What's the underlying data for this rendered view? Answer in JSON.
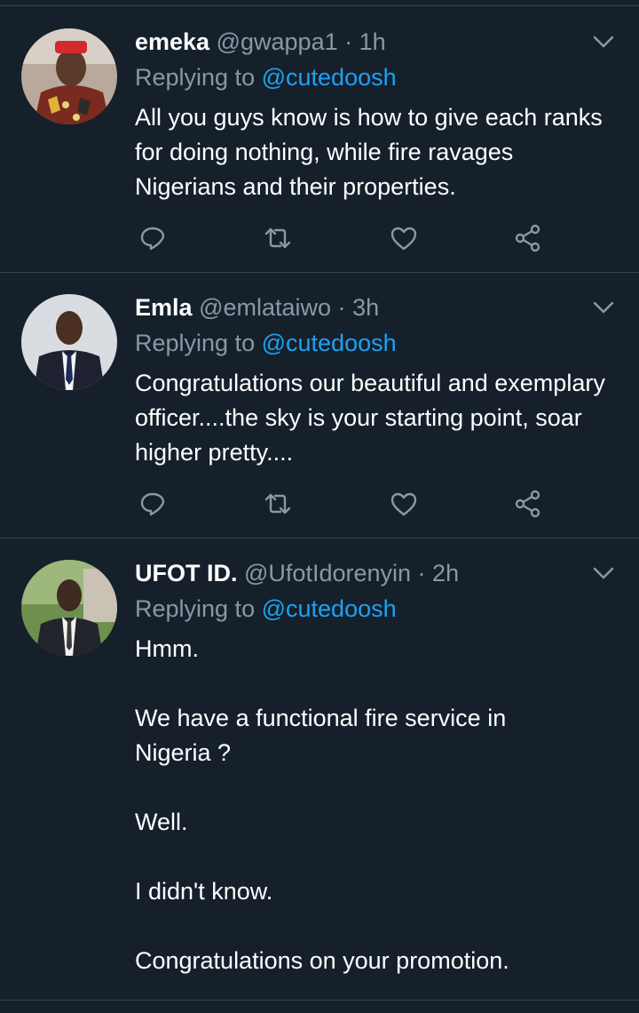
{
  "tweets": [
    {
      "display_name": "emeka",
      "handle": "@gwappa1",
      "separator": "·",
      "time": "1h",
      "replying_prefix": "Replying to",
      "replying_to": "@cutedoosh",
      "body": [
        "All you guys know is how to give each ranks for doing nothing, while fire ravages Nigerians and their properties."
      ]
    },
    {
      "display_name": "Emla",
      "handle": "@emlataiwo",
      "separator": "·",
      "time": "3h",
      "replying_prefix": "Replying to",
      "replying_to": "@cutedoosh",
      "body": [
        "Congratulations our beautiful and exemplary officer....the sky is your starting point, soar higher pretty...."
      ]
    },
    {
      "display_name": "UFOT ID.",
      "handle": "@UfotIdorenyin",
      "separator": "·",
      "time": "2h",
      "replying_prefix": "Replying to",
      "replying_to": "@cutedoosh",
      "body": [
        "Hmm.",
        "We have a functional fire service in Nigeria ?",
        "Well.",
        "I didn't know.",
        "Congratulations on your promotion."
      ]
    }
  ],
  "icons": {
    "reply": "reply-icon",
    "retweet": "retweet-icon",
    "like": "like-icon",
    "share": "share-icon",
    "menu": "chevron-down-icon"
  },
  "colors": {
    "background": "#15202b",
    "divider": "#38444d",
    "secondary_text": "#8899a6",
    "accent": "#1da1f2",
    "primary_text": "#ffffff"
  }
}
